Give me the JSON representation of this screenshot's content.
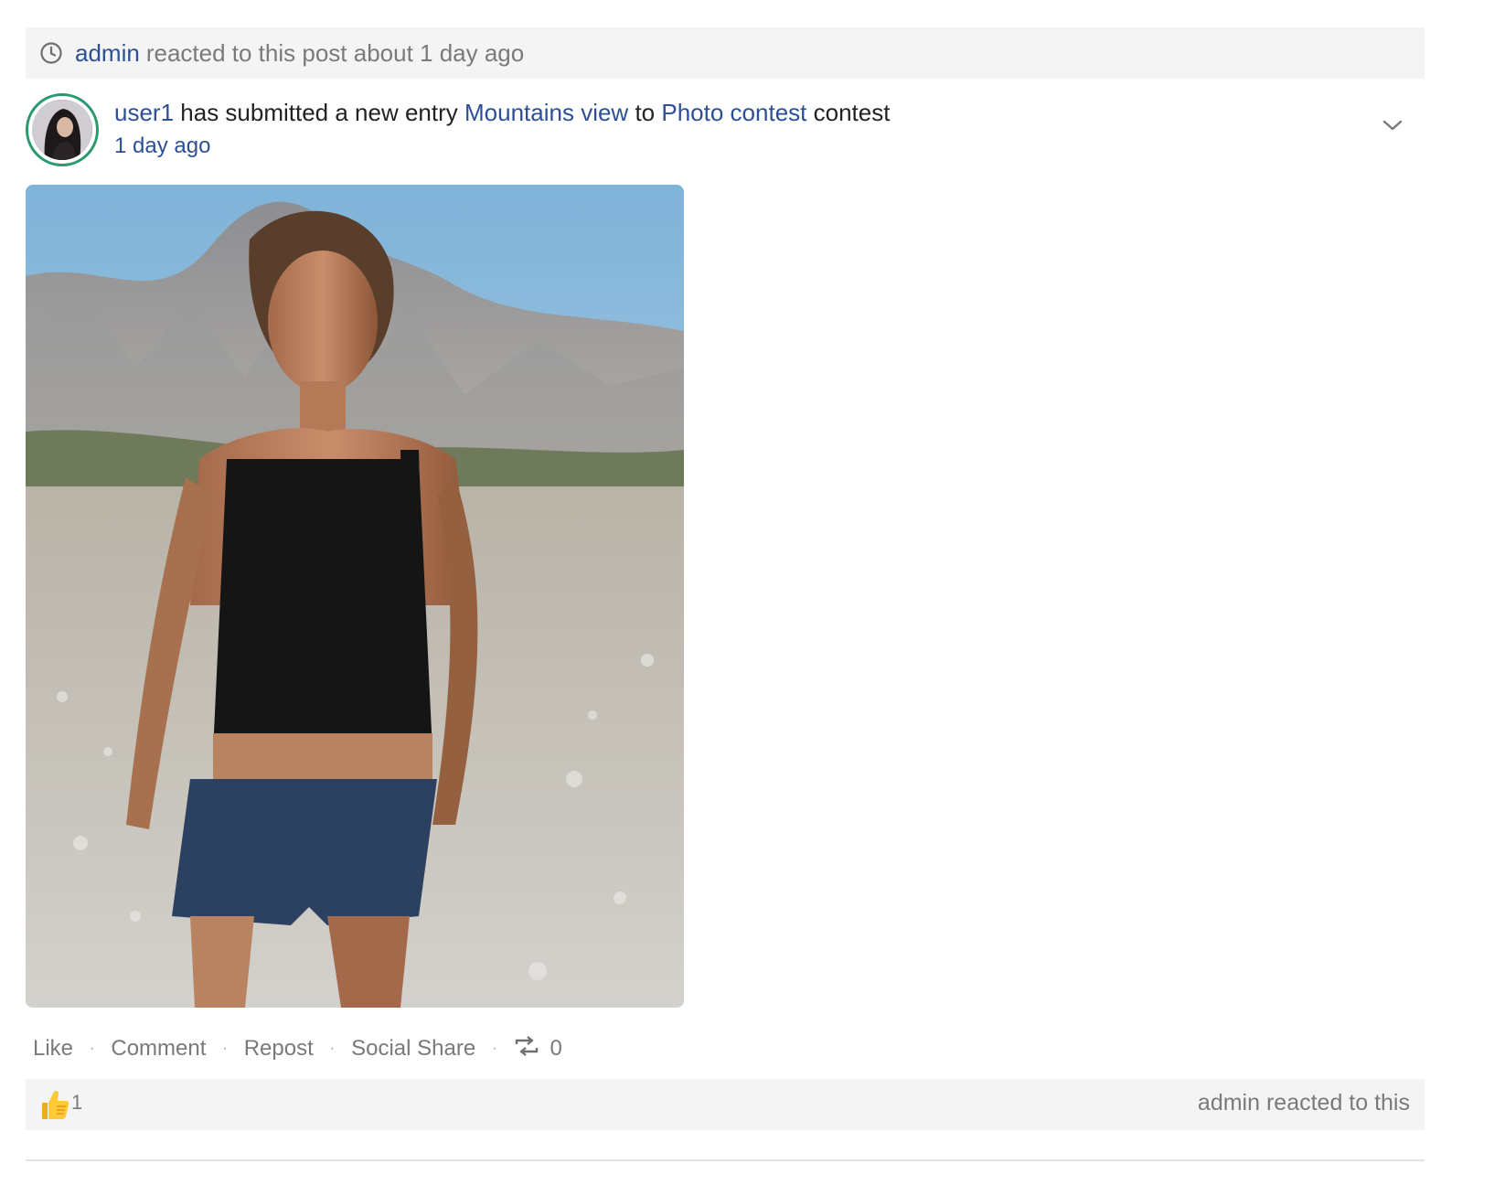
{
  "notice": {
    "icon": "clock-icon",
    "user": "admin",
    "text": "reacted to this post about 1 day ago"
  },
  "post": {
    "avatar_alt": "user1",
    "author": "user1",
    "action_text": "has submitted a new entry",
    "entry_title": "Mountains view",
    "connector": "to",
    "contest_name": "Photo contest",
    "suffix": "contest",
    "time": "1 day ago",
    "menu_icon": "chevron-down-icon",
    "photo_alt": "Mountains view"
  },
  "actions": {
    "like": "Like",
    "comment": "Comment",
    "repost": "Repost",
    "social_share": "Social Share",
    "separator": "·",
    "repost_icon": "repost-icon",
    "repost_count": "0"
  },
  "reactions": {
    "icon": "thumbs-up-icon",
    "count": "1",
    "summary": "admin reacted to this"
  },
  "colors": {
    "link": "#2c4f96",
    "muted_text": "#7a7a7a",
    "bar_background": "#f4f4f4",
    "avatar_ring": "#2a9a6e"
  }
}
